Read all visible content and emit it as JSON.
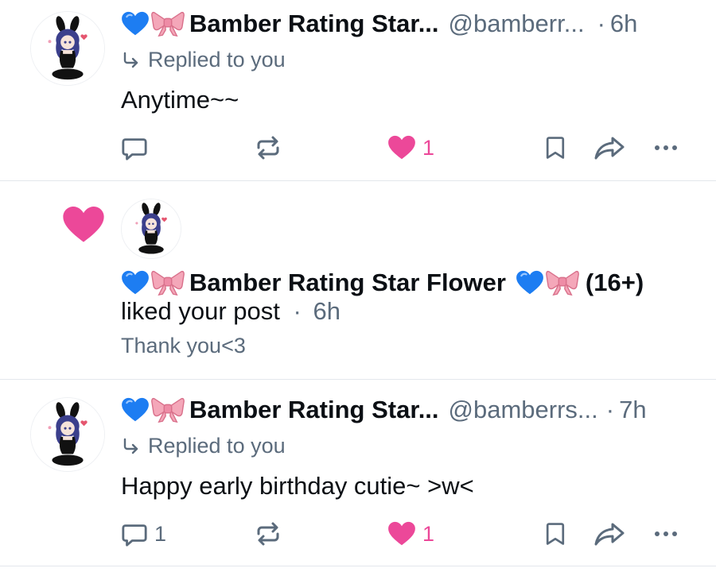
{
  "colors": {
    "accent_pink": "#ec4899",
    "muted_text": "#5b6b7c",
    "icon_gray": "#5b6b7c",
    "divider": "#e3e7ec"
  },
  "notifications": [
    {
      "type": "reply",
      "author_name": "Bamber Rating Star...",
      "handle": "@bamberr...",
      "separator": "·",
      "time": "6h",
      "replied_label": "Replied to you",
      "text": "Anytime~~",
      "reply_count": "",
      "like_count": "1",
      "icons": [
        "reply-icon",
        "repost-icon",
        "like-icon",
        "bookmark-icon",
        "share-icon",
        "more-icon"
      ]
    },
    {
      "type": "like",
      "author_name": "Bamber Rating Star Flower",
      "suffix": "(16+)",
      "action_text": "liked your post",
      "separator": "·",
      "time": "6h",
      "post_preview": "Thank you<3"
    },
    {
      "type": "reply",
      "author_name": "Bamber Rating Star...",
      "handle": "@bamberrs...",
      "separator": "·",
      "time": "7h",
      "replied_label": "Replied to you",
      "text": "Happy early birthday cutie~ >w<",
      "reply_count": "1",
      "like_count": "1",
      "icons": [
        "reply-icon",
        "repost-icon",
        "like-icon",
        "bookmark-icon",
        "share-icon",
        "more-icon"
      ]
    }
  ]
}
